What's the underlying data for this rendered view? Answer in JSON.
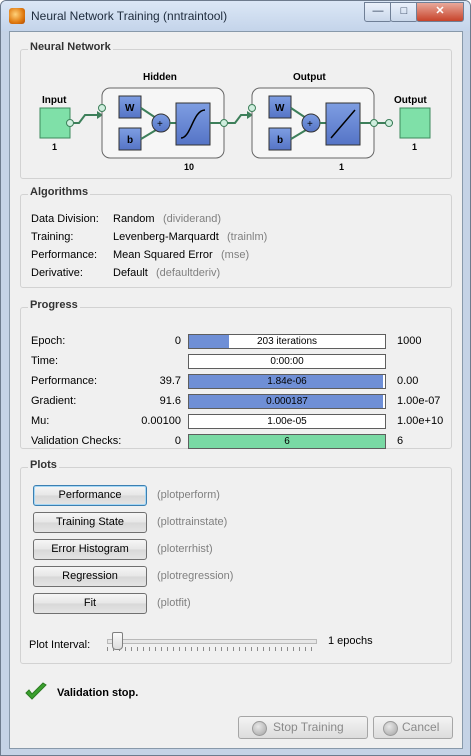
{
  "window": {
    "title": "Neural Network Training (nntraintool)"
  },
  "neural_network": {
    "panel_title": "Neural Network",
    "input_label": "Input",
    "input_size": "1",
    "hidden_label": "Hidden",
    "hidden_size": "10",
    "output_layer_label": "Output",
    "output_layer_size": "1",
    "output_label": "Output",
    "output_size": "1",
    "w_label": "W",
    "b_label": "b",
    "plus_label": "+"
  },
  "algorithms": {
    "panel_title": "Algorithms",
    "rows": [
      {
        "label": "Data Division:",
        "value": "Random",
        "code": "(dividerand)"
      },
      {
        "label": "Training:",
        "value": "Levenberg-Marquardt",
        "code": "(trainlm)"
      },
      {
        "label": "Performance:",
        "value": "Mean Squared Error",
        "code": "(mse)"
      },
      {
        "label": "Derivative:",
        "value": "Default",
        "code": "(defaultderiv)"
      }
    ]
  },
  "progress": {
    "panel_title": "Progress",
    "rows": [
      {
        "label": "Epoch:",
        "start": "0",
        "current": "203 iterations",
        "end": "1000",
        "fraction": 0.203,
        "color": "#6f8fd6"
      },
      {
        "label": "Time:",
        "start": "",
        "current": "0:00:00",
        "end": "",
        "fraction": 0,
        "color": "#6f8fd6"
      },
      {
        "label": "Performance:",
        "start": "39.7",
        "current": "1.84e-06",
        "end": "0.00",
        "fraction": 0.99,
        "color": "#6f8fd6"
      },
      {
        "label": "Gradient:",
        "start": "91.6",
        "current": "0.000187",
        "end": "1.00e-07",
        "fraction": 0.99,
        "color": "#6f8fd6"
      },
      {
        "label": "Mu:",
        "start": "0.00100",
        "current": "1.00e-05",
        "end": "1.00e+10",
        "fraction": 0,
        "color": "#6f8fd6"
      },
      {
        "label": "Validation Checks:",
        "start": "0",
        "current": "6",
        "end": "6",
        "fraction": 1.0,
        "color": "#79d9a4"
      }
    ]
  },
  "plots": {
    "panel_title": "Plots",
    "buttons": [
      {
        "label": "Performance",
        "code": "(plotperform)"
      },
      {
        "label": "Training State",
        "code": "(plottrainstate)"
      },
      {
        "label": "Error Histogram",
        "code": "(ploterrhist)"
      },
      {
        "label": "Regression",
        "code": "(plotregression)"
      },
      {
        "label": "Fit",
        "code": "(plotfit)"
      }
    ],
    "interval_label": "Plot Interval:",
    "interval_value": "1 epochs"
  },
  "status": {
    "text": "Validation stop.",
    "icon": "checkmark-icon",
    "color": "#3aa02e"
  },
  "actions": {
    "stop_label": "Stop Training",
    "cancel_label": "Cancel"
  },
  "colors": {
    "layer_fill": "#6f8fd6",
    "io_fill": "#7fe0a8",
    "validation_fill": "#79d9a4"
  }
}
